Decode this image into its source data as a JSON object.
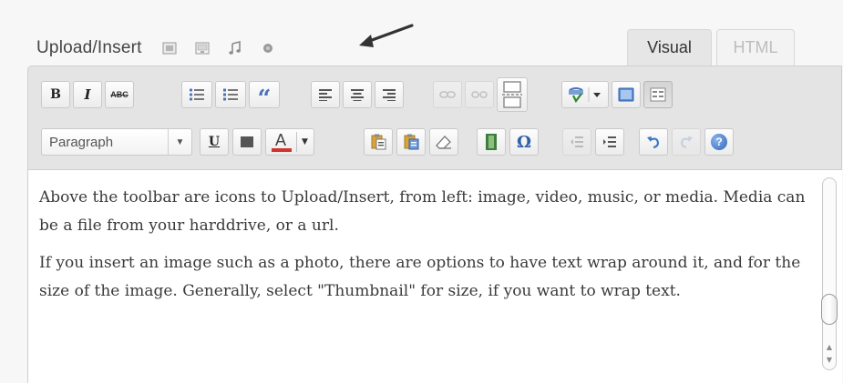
{
  "upload_insert": {
    "label": "Upload/Insert",
    "icons": [
      "add-image-icon",
      "add-video-icon",
      "add-audio-icon",
      "add-media-icon"
    ]
  },
  "tabs": {
    "visual": "Visual",
    "html": "HTML",
    "active": "Visual"
  },
  "toolbar_row1": [
    {
      "name": "bold-button",
      "icon": "bold-icon",
      "text": "B"
    },
    {
      "name": "italic-button",
      "icon": "italic-icon",
      "text": "I"
    },
    {
      "name": "strikethrough-button",
      "icon": "strikethrough-icon",
      "text": "ABC"
    },
    {
      "name": "bulleted-list-button",
      "icon": "bulleted-list-icon"
    },
    {
      "name": "numbered-list-button",
      "icon": "numbered-list-icon"
    },
    {
      "name": "blockquote-button",
      "icon": "blockquote-icon",
      "text": "“"
    },
    {
      "name": "align-left-button",
      "icon": "align-left-icon"
    },
    {
      "name": "align-center-button",
      "icon": "align-center-icon"
    },
    {
      "name": "align-right-button",
      "icon": "align-right-icon"
    },
    {
      "name": "insert-link-button",
      "icon": "link-icon",
      "disabled": true
    },
    {
      "name": "unlink-button",
      "icon": "unlink-icon",
      "disabled": true
    },
    {
      "name": "insert-more-tag-button",
      "icon": "more-tag-icon"
    },
    {
      "name": "spellcheck-button",
      "icon": "spellcheck-icon"
    },
    {
      "name": "fullscreen-button",
      "icon": "fullscreen-icon"
    },
    {
      "name": "kitchen-sink-button",
      "icon": "kitchen-sink-icon",
      "pressed": true
    }
  ],
  "toolbar_row2": {
    "format_select": "Paragraph",
    "buttons": [
      {
        "name": "underline-button",
        "icon": "underline-icon",
        "text": "U"
      },
      {
        "name": "justify-button",
        "icon": "justify-icon"
      },
      {
        "name": "text-color-button",
        "icon": "text-color-icon",
        "text": "A"
      },
      {
        "name": "paste-as-text-button",
        "icon": "paste-text-icon"
      },
      {
        "name": "paste-from-word-button",
        "icon": "paste-word-icon"
      },
      {
        "name": "remove-formatting-button",
        "icon": "eraser-icon"
      },
      {
        "name": "insert-media-button",
        "icon": "film-icon"
      },
      {
        "name": "special-character-button",
        "icon": "omega-icon",
        "text": "Ω"
      },
      {
        "name": "outdent-button",
        "icon": "outdent-icon",
        "disabled": true
      },
      {
        "name": "indent-button",
        "icon": "indent-icon"
      },
      {
        "name": "undo-button",
        "icon": "undo-icon"
      },
      {
        "name": "redo-button",
        "icon": "redo-icon",
        "disabled": true
      },
      {
        "name": "help-button",
        "icon": "help-icon",
        "text": "?"
      }
    ]
  },
  "colors": {
    "toolbar_bg": "#e4e4e4",
    "text_color_bar": "#d0342c",
    "accent_blue": "#3c78c8"
  },
  "content": {
    "paragraphs": [
      "Above the toolbar are icons to Upload/Insert, from left: image, video, music, or media.  Media can be a file from your harddrive, or a url.",
      "If you insert an image such as a photo, there are options to have text wrap around it, and for the size of the image.  Generally, select \"Thumbnail\" for size, if you want to wrap text."
    ]
  }
}
